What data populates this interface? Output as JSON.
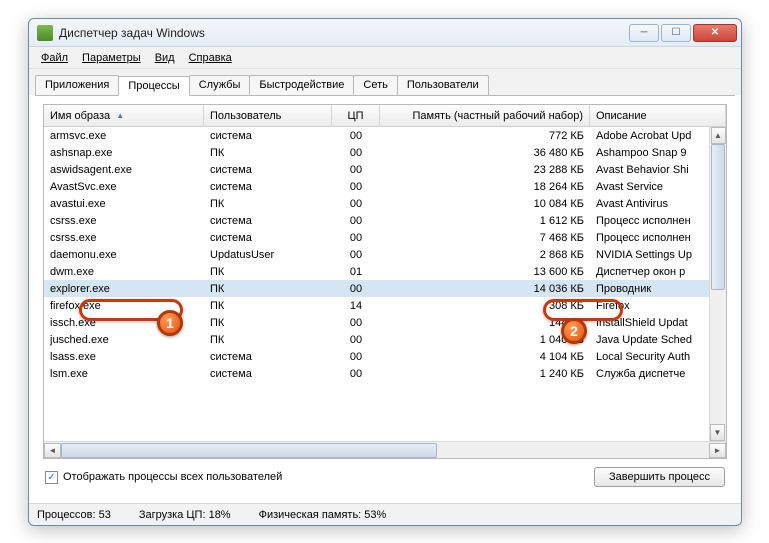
{
  "title": "Диспетчер задач Windows",
  "menu": {
    "file": "Файл",
    "options": "Параметры",
    "view": "Вид",
    "help": "Справка"
  },
  "tabs": {
    "apps": "Приложения",
    "processes": "Процессы",
    "services": "Службы",
    "performance": "Быстродействие",
    "network": "Сеть",
    "users": "Пользователи"
  },
  "columns": {
    "image": "Имя образа",
    "user": "Пользователь",
    "cpu": "ЦП",
    "memory": "Память (частный рабочий набор)",
    "description": "Описание"
  },
  "rows": [
    {
      "img": "armsvc.exe",
      "user": "система",
      "cpu": "00",
      "mem": "772 КБ",
      "desc": "Adobe Acrobat Upd"
    },
    {
      "img": "ashsnap.exe",
      "user": "ПК",
      "cpu": "00",
      "mem": "36 480 КБ",
      "desc": "Ashampoo Snap 9"
    },
    {
      "img": "aswidsagent.exe",
      "user": "система",
      "cpu": "00",
      "mem": "23 288 КБ",
      "desc": "Avast Behavior Shi"
    },
    {
      "img": "AvastSvc.exe",
      "user": "система",
      "cpu": "00",
      "mem": "18 264 КБ",
      "desc": "Avast Service"
    },
    {
      "img": "avastui.exe",
      "user": "ПК",
      "cpu": "00",
      "mem": "10 084 КБ",
      "desc": "Avast Antivirus"
    },
    {
      "img": "csrss.exe",
      "user": "система",
      "cpu": "00",
      "mem": "1 612 КБ",
      "desc": "Процесс исполнен"
    },
    {
      "img": "csrss.exe",
      "user": "система",
      "cpu": "00",
      "mem": "7 468 КБ",
      "desc": "Процесс исполнен"
    },
    {
      "img": "daemonu.exe",
      "user": "UpdatusUser",
      "cpu": "00",
      "mem": "2 868 КБ",
      "desc": "NVIDIA Settings Up"
    },
    {
      "img": "dwm.exe",
      "user": "ПК",
      "cpu": "01",
      "mem": "13 600 КБ",
      "desc": "Диспетчер окон р"
    },
    {
      "img": "explorer.exe",
      "user": "ПК",
      "cpu": "00",
      "mem": "14 036 КБ",
      "desc": "Проводник",
      "sel": true
    },
    {
      "img": "firefox.exe",
      "user": "ПК",
      "cpu": "14",
      "mem": "308 КБ",
      "desc": "Firefox"
    },
    {
      "img": "issch.exe",
      "user": "ПК",
      "cpu": "00",
      "mem": "144 КБ",
      "desc": "InstallShield Updat"
    },
    {
      "img": "jusched.exe",
      "user": "ПК",
      "cpu": "00",
      "mem": "1 040 КБ",
      "desc": "Java Update Sched"
    },
    {
      "img": "lsass.exe",
      "user": "система",
      "cpu": "00",
      "mem": "4 104 КБ",
      "desc": "Local Security Auth"
    },
    {
      "img": "lsm.exe",
      "user": "система",
      "cpu": "00",
      "mem": "1 240 КБ",
      "desc": "Служба диспетче"
    }
  ],
  "checkbox": {
    "checked": true,
    "label": "Отображать процессы всех пользователей"
  },
  "endButton": "Завершить процесс",
  "status": {
    "processes": "Процессов: 53",
    "cpu": "Загрузка ЦП: 18%",
    "mem": "Физическая память: 53%"
  },
  "badges": {
    "b1": "1",
    "b2": "2"
  }
}
